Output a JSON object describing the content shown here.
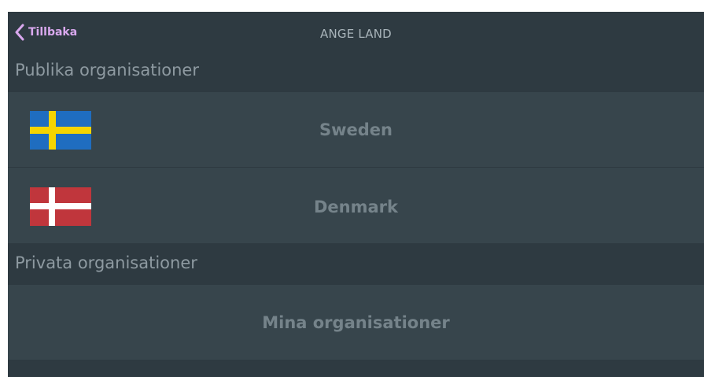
{
  "header": {
    "back_label": "Tillbaka",
    "title": "ANGE LAND"
  },
  "sections": {
    "public": {
      "title": "Publika organisationer",
      "items": [
        {
          "label": "Sweden",
          "flag": "sweden-flag-icon"
        },
        {
          "label": "Denmark",
          "flag": "denmark-flag-icon"
        }
      ]
    },
    "private": {
      "title": "Privata organisationer",
      "items": [
        {
          "label": "Mina organisationer"
        }
      ]
    }
  },
  "colors": {
    "background": "#2e3a41",
    "row": "#37454c",
    "accent": "#d9a8ee",
    "sweden_blue": "#1f6dc0",
    "sweden_yellow": "#f5d400",
    "denmark_red": "#c0363c"
  }
}
